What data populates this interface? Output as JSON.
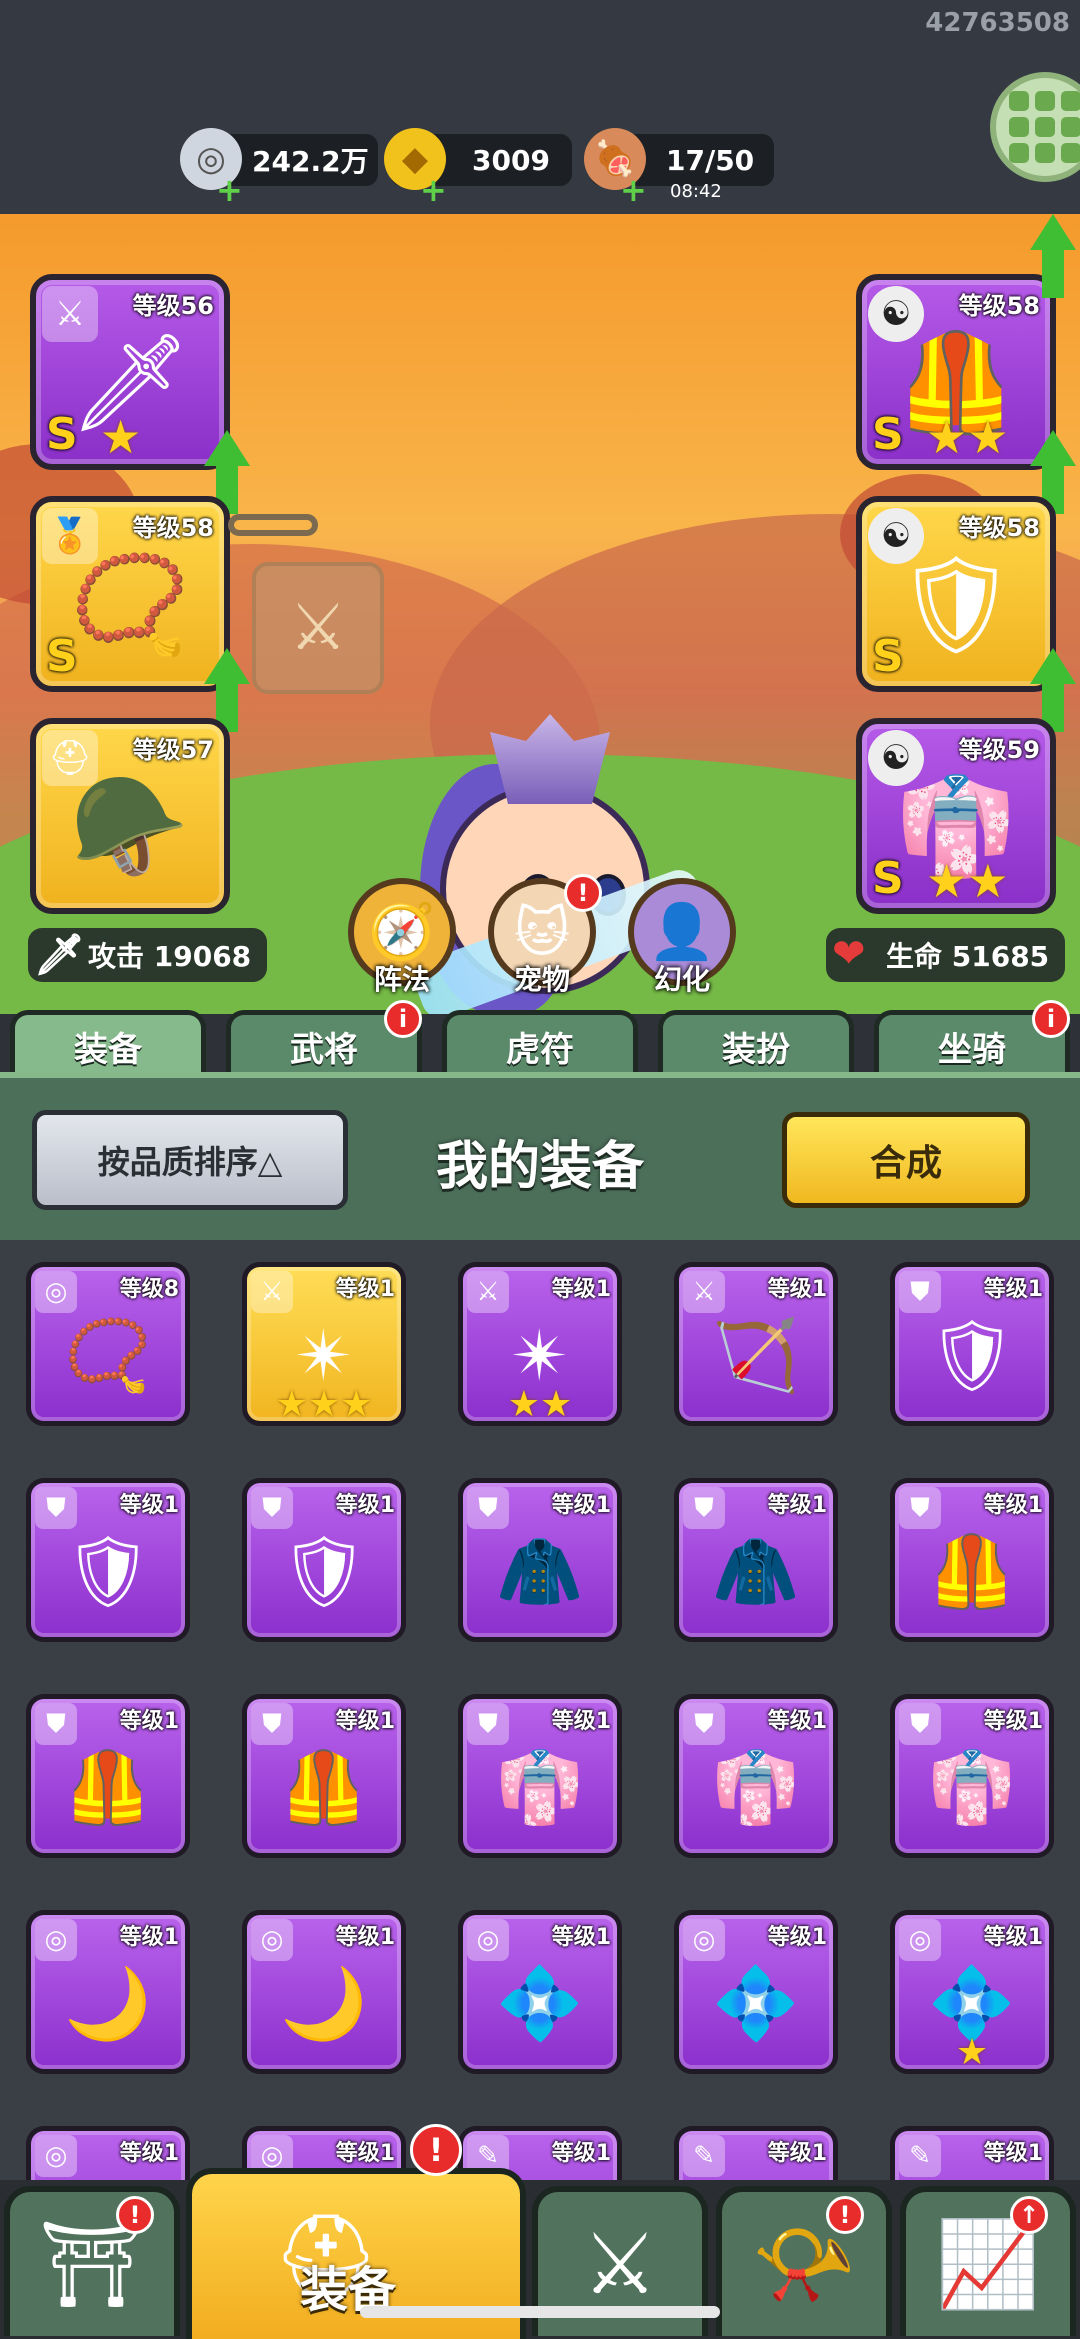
{
  "user_id": "42763508",
  "resources": {
    "silver": {
      "value": "242.2万",
      "icon": "coin-icon"
    },
    "gold": {
      "value": "3009",
      "icon": "gold-ingot-icon"
    },
    "stamina": {
      "value": "17/50",
      "timer": "08:42",
      "icon": "meat-icon"
    }
  },
  "equipment_slots": {
    "weapon": {
      "level": "等级56",
      "grade": "S",
      "stars": "★"
    },
    "amulet": {
      "level": "等级58",
      "grade": "S",
      "stars": ""
    },
    "helmet": {
      "level": "等级57",
      "grade": "",
      "stars": ""
    },
    "armor": {
      "level": "等级58",
      "grade": "S",
      "stars": "★★"
    },
    "belt": {
      "level": "等级58",
      "grade": "S",
      "stars": ""
    },
    "boots": {
      "level": "等级59",
      "grade": "S",
      "stars": "★★"
    }
  },
  "stats": {
    "attack": "攻击 19068",
    "hp": "生命 51685"
  },
  "features": {
    "formation": "阵法",
    "pet": "宠物",
    "transform": "幻化",
    "pet_badge": "!"
  },
  "tabs": [
    {
      "label": "装备",
      "badge": ""
    },
    {
      "label": "武将",
      "badge": "i"
    },
    {
      "label": "虎符",
      "badge": ""
    },
    {
      "label": "装扮",
      "badge": ""
    },
    {
      "label": "坐骑",
      "badge": "i"
    }
  ],
  "panel": {
    "sort_label": "按品质排序△",
    "title": "我的装备",
    "craft_label": "合成"
  },
  "inventory": [
    {
      "level": "等级8",
      "color": "purple",
      "tag": "◎",
      "art": "📿",
      "stars": ""
    },
    {
      "level": "等级1",
      "color": "gold",
      "tag": "⚔",
      "art": "✴",
      "stars": "★★★"
    },
    {
      "level": "等级1",
      "color": "purple",
      "tag": "⚔",
      "art": "✴",
      "stars": "★★"
    },
    {
      "level": "等级1",
      "color": "purple",
      "tag": "⚔",
      "art": "🏹",
      "stars": ""
    },
    {
      "level": "等级1",
      "color": "purple",
      "tag": "⛊",
      "art": "🛡",
      "stars": ""
    },
    {
      "level": "等级1",
      "color": "purple",
      "tag": "⛊",
      "art": "🛡",
      "stars": ""
    },
    {
      "level": "等级1",
      "color": "purple",
      "tag": "⛊",
      "art": "🛡",
      "stars": ""
    },
    {
      "level": "等级1",
      "color": "purple",
      "tag": "⛊",
      "art": "🧥",
      "stars": ""
    },
    {
      "level": "等级1",
      "color": "purple",
      "tag": "⛊",
      "art": "🧥",
      "stars": ""
    },
    {
      "level": "等级1",
      "color": "purple",
      "tag": "⛊",
      "art": "🦺",
      "stars": ""
    },
    {
      "level": "等级1",
      "color": "purple",
      "tag": "⛊",
      "art": "🦺",
      "stars": ""
    },
    {
      "level": "等级1",
      "color": "purple",
      "tag": "⛊",
      "art": "🦺",
      "stars": ""
    },
    {
      "level": "等级1",
      "color": "purple",
      "tag": "⛊",
      "art": "👘",
      "stars": ""
    },
    {
      "level": "等级1",
      "color": "purple",
      "tag": "⛊",
      "art": "👘",
      "stars": ""
    },
    {
      "level": "等级1",
      "color": "purple",
      "tag": "⛊",
      "art": "👘",
      "stars": ""
    },
    {
      "level": "等级1",
      "color": "purple",
      "tag": "◎",
      "art": "🌙",
      "stars": ""
    },
    {
      "level": "等级1",
      "color": "purple",
      "tag": "◎",
      "art": "🌙",
      "stars": ""
    },
    {
      "level": "等级1",
      "color": "purple",
      "tag": "◎",
      "art": "💠",
      "stars": ""
    },
    {
      "level": "等级1",
      "color": "purple",
      "tag": "◎",
      "art": "💠",
      "stars": ""
    },
    {
      "level": "等级1",
      "color": "purple",
      "tag": "◎",
      "art": "💠",
      "stars": "★"
    },
    {
      "level": "等级1",
      "color": "purple",
      "tag": "◎",
      "art": "",
      "stars": ""
    },
    {
      "level": "等级1",
      "color": "purple",
      "tag": "◎",
      "art": "",
      "stars": ""
    },
    {
      "level": "等级1",
      "color": "purple",
      "tag": "✎",
      "art": "",
      "stars": ""
    },
    {
      "level": "等级1",
      "color": "purple",
      "tag": "✎",
      "art": "",
      "stars": ""
    },
    {
      "level": "等级1",
      "color": "purple",
      "tag": "✎",
      "art": "",
      "stars": ""
    }
  ],
  "bottom_nav": {
    "active_label": "装备",
    "items": [
      "shop-gate-icon",
      "helmet-icon",
      "crossed-swords-icon",
      "horn-icon",
      "upgrade-icon"
    ]
  }
}
